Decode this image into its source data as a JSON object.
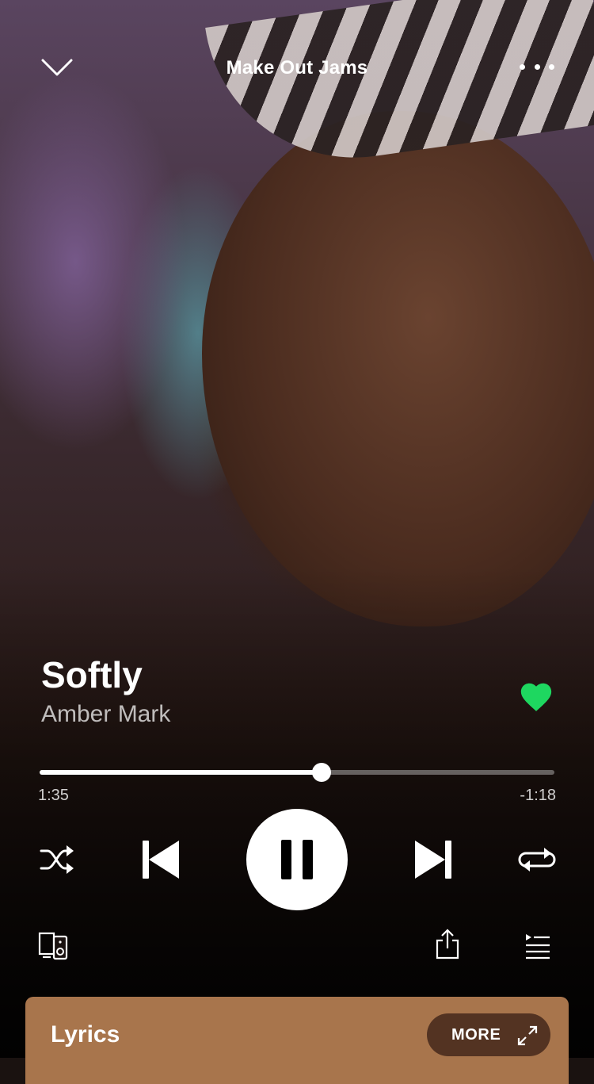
{
  "header": {
    "playlist_name": "Make Out Jams"
  },
  "track": {
    "title": "Softly",
    "artist": "Amber Mark",
    "liked": true
  },
  "playback": {
    "elapsed": "1:35",
    "remaining": "-1:18",
    "progress_fraction": 0.548,
    "is_playing": true
  },
  "lyrics_card": {
    "label": "Lyrics",
    "more_label": "MORE"
  },
  "colors": {
    "like_green": "#1ed760",
    "lyrics_card_bg": "#a8754c"
  },
  "icons": {
    "collapse": "chevron-down-icon",
    "options": "more-options-icon",
    "like": "heart-icon",
    "shuffle": "shuffle-icon",
    "previous": "skip-previous-icon",
    "pause": "pause-icon",
    "next": "skip-next-icon",
    "repeat": "repeat-icon",
    "devices": "devices-icon",
    "share": "share-icon",
    "queue": "queue-icon",
    "expand": "expand-icon"
  }
}
